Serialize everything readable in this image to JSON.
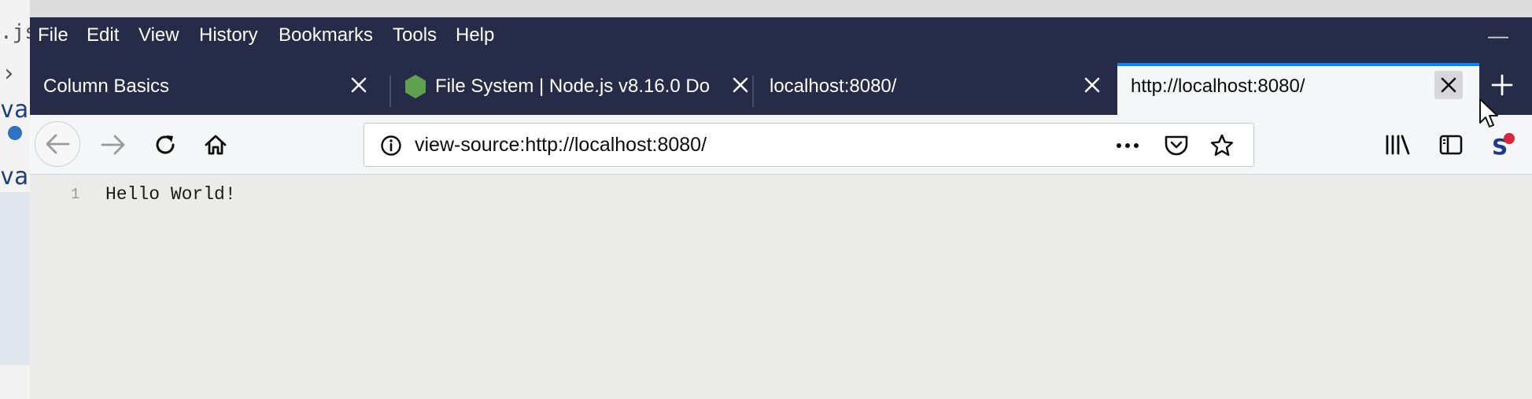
{
  "background_editor": {
    "top_text": ".js",
    "chevron": "›",
    "line_a": "va",
    "line_b": "va"
  },
  "menubar": {
    "items": [
      "File",
      "Edit",
      "View",
      "History",
      "Bookmarks",
      "Tools",
      "Help"
    ],
    "minimize": "—"
  },
  "tabs": [
    {
      "label": "Column Basics",
      "active": false,
      "icon": null
    },
    {
      "label": "File System | Node.js v8.16.0 Do",
      "active": false,
      "icon": "nodejs-hexagon-icon"
    },
    {
      "label": "localhost:8080/",
      "active": false,
      "icon": null
    },
    {
      "label": "http://localhost:8080/",
      "active": true,
      "icon": null
    }
  ],
  "navbar": {
    "url": "view-source:http://localhost:8080/"
  },
  "content": {
    "line_number": "1",
    "code": "Hello World!"
  },
  "colors": {
    "menubar_bg": "#262b48",
    "active_tab_accent": "#0a84ff",
    "content_bg": "#ebebe9"
  }
}
